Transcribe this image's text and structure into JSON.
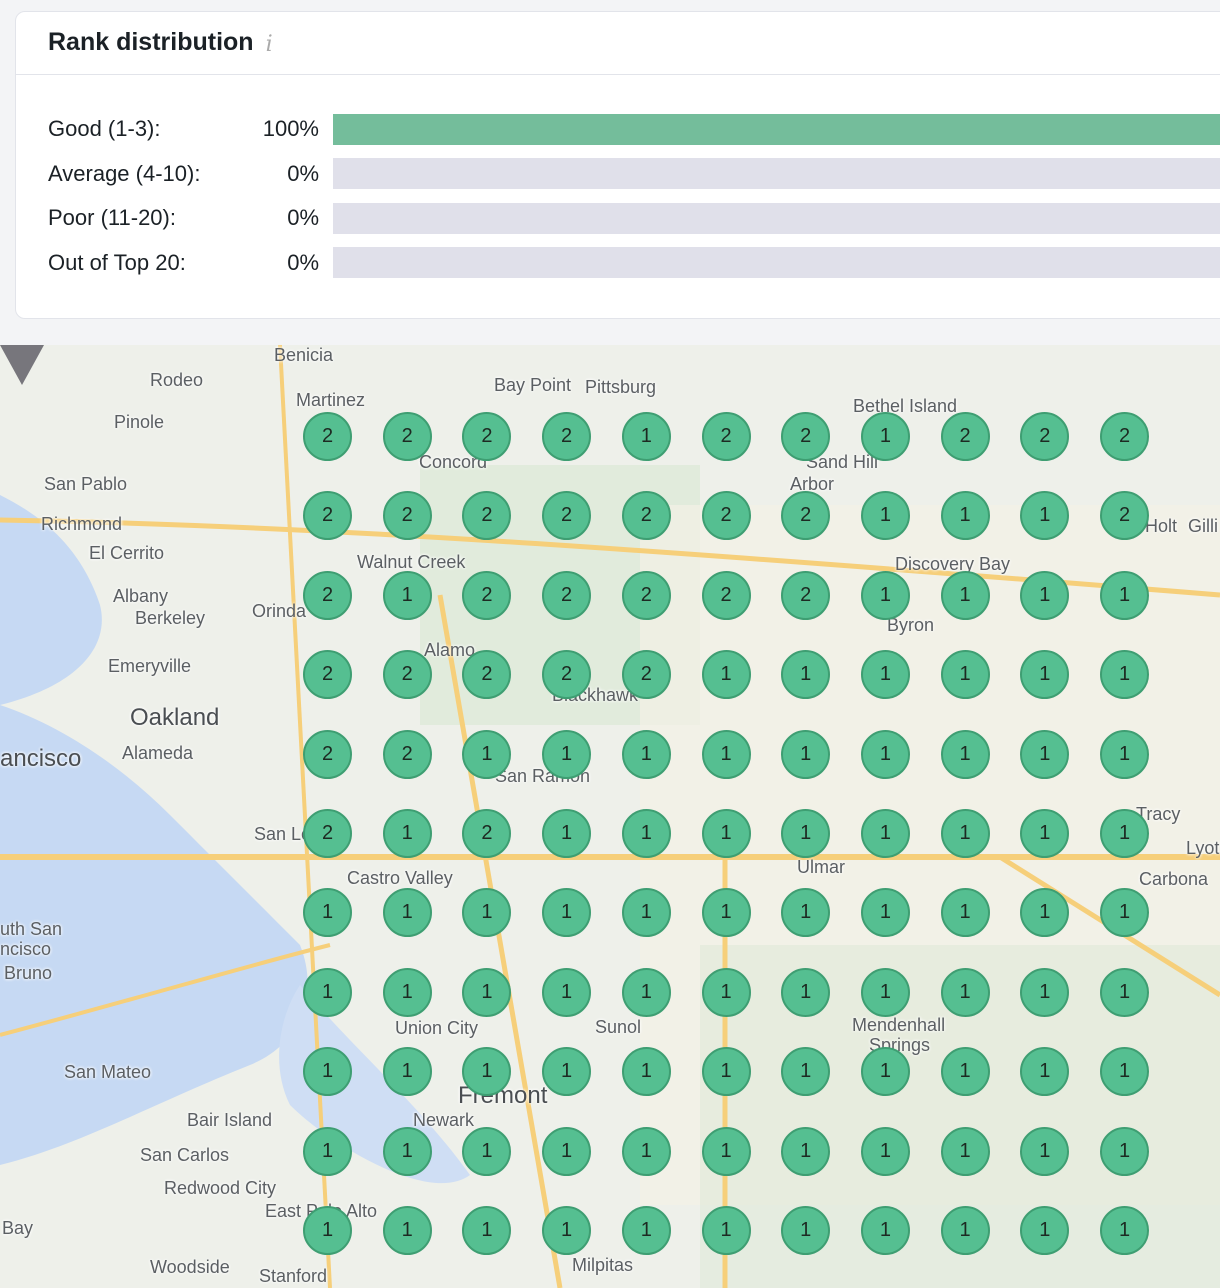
{
  "card": {
    "title": "Rank distribution",
    "info_icon": "info-icon",
    "rows": [
      {
        "label": "Good (1-3):",
        "percent": "100%",
        "value": 100,
        "color": "#74bd9b"
      },
      {
        "label": "Average (4-10):",
        "percent": "0%",
        "value": 0
      },
      {
        "label": "Poor (11-20):",
        "percent": "0%",
        "value": 0
      },
      {
        "label": "Out of Top 20:",
        "percent": "0%",
        "value": 0
      }
    ]
  },
  "map": {
    "places": [
      "Benicia",
      "Rodeo",
      "Martinez",
      "Bay Point",
      "Pittsburg",
      "Bethel Island",
      "Pinole",
      "Concord",
      "Sand Hill",
      "Arbor",
      "San Pablo",
      "Richmond",
      "El Cerrito",
      "Walnut Creek",
      "Discovery Bay",
      "Albany",
      "Berkeley",
      "Orinda",
      "Byron",
      "Emeryville",
      "Alamo",
      "Oakland",
      "Blackhawk",
      "ancisco",
      "Alameda",
      "San Ramon",
      "Tracy",
      "San Le",
      "Castro Valley",
      "Ulmar",
      "Carbona",
      "uth San",
      "ncisco",
      "Bruno",
      "Union City",
      "Sunol",
      "Mendenhall",
      "Springs",
      "San Mateo",
      "Fremont",
      "Bair Island",
      "Newark",
      "San Carlos",
      "Redwood City",
      "East Palo Alto",
      "Bay",
      "Woodside",
      "Stanford",
      "Milpitas",
      "Gilli",
      "Lyot",
      "Holt"
    ],
    "grid": [
      [
        2,
        2,
        2,
        2,
        1,
        2,
        2,
        1,
        2,
        2,
        2
      ],
      [
        2,
        2,
        2,
        2,
        2,
        2,
        2,
        1,
        1,
        1,
        2
      ],
      [
        2,
        1,
        2,
        2,
        2,
        2,
        2,
        1,
        1,
        1,
        1
      ],
      [
        2,
        2,
        2,
        2,
        2,
        1,
        1,
        1,
        1,
        1,
        1
      ],
      [
        2,
        2,
        1,
        1,
        1,
        1,
        1,
        1,
        1,
        1,
        1
      ],
      [
        2,
        1,
        2,
        1,
        1,
        1,
        1,
        1,
        1,
        1,
        1
      ],
      [
        1,
        1,
        1,
        1,
        1,
        1,
        1,
        1,
        1,
        1,
        1
      ],
      [
        1,
        1,
        1,
        1,
        1,
        1,
        1,
        1,
        1,
        1,
        1
      ],
      [
        1,
        1,
        1,
        1,
        1,
        1,
        1,
        1,
        1,
        1,
        1
      ],
      [
        1,
        1,
        1,
        1,
        1,
        1,
        1,
        1,
        1,
        1,
        1
      ],
      [
        1,
        1,
        1,
        1,
        1,
        1,
        1,
        1,
        1,
        1,
        1
      ]
    ]
  }
}
